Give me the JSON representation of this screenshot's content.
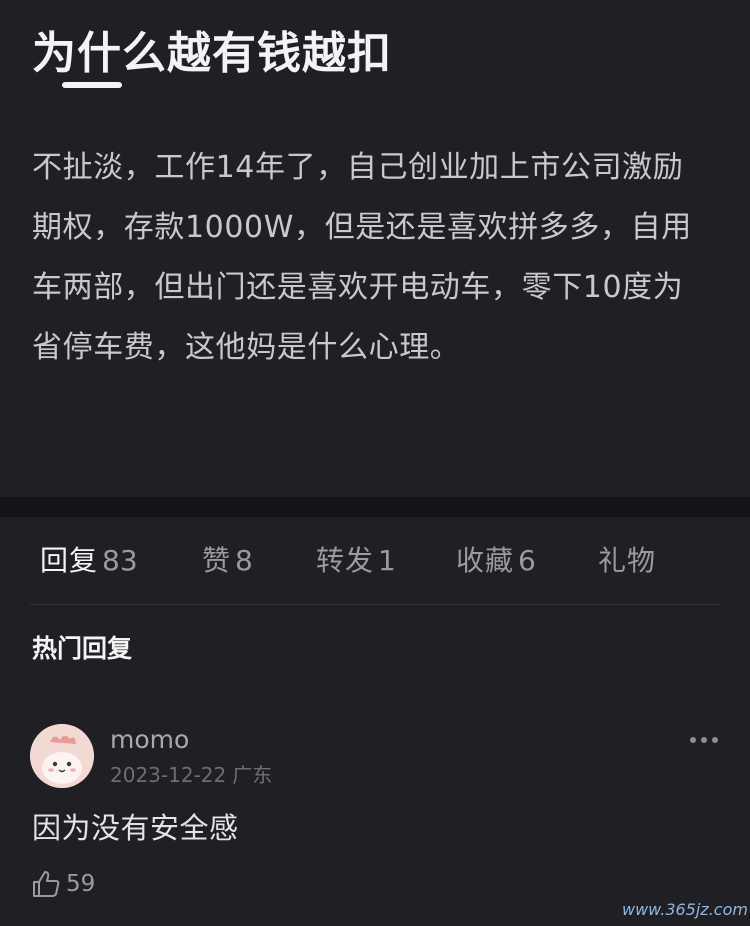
{
  "post": {
    "title": "为什么越有钱越扣",
    "body": "不扯淡，工作14年了，自己创业加上市公司激励期权，存款1000W，但是还是喜欢拼多多，自用车两部，但出门还是喜欢开电动车，零下10度为省停车费，这他妈是什么心理。"
  },
  "tabs": [
    {
      "label": "回复",
      "count": "83",
      "active": true
    },
    {
      "label": "赞",
      "count": "8",
      "active": false
    },
    {
      "label": "转发",
      "count": "1",
      "active": false
    },
    {
      "label": "收藏",
      "count": "6",
      "active": false
    },
    {
      "label": "礼物",
      "count": "",
      "active": false
    }
  ],
  "hot_replies": {
    "title": "热门回复",
    "comments": [
      {
        "username": "momo",
        "date": "2023-12-22",
        "location": "广东",
        "text": "因为没有安全感",
        "likes": "59",
        "avatar_icon": "pink-cartoon-avatar",
        "more_icon": "more-dots-icon",
        "like_icon": "thumbs-up-icon"
      }
    ]
  },
  "watermark": "www.365jz.com",
  "colors": {
    "background": "#1f1f24",
    "separator": "#141417",
    "title": "#f4f4f6",
    "body_text": "#c9c9cd",
    "muted": "#9a9a9f",
    "avatar_bg": "#f3d9d4"
  }
}
